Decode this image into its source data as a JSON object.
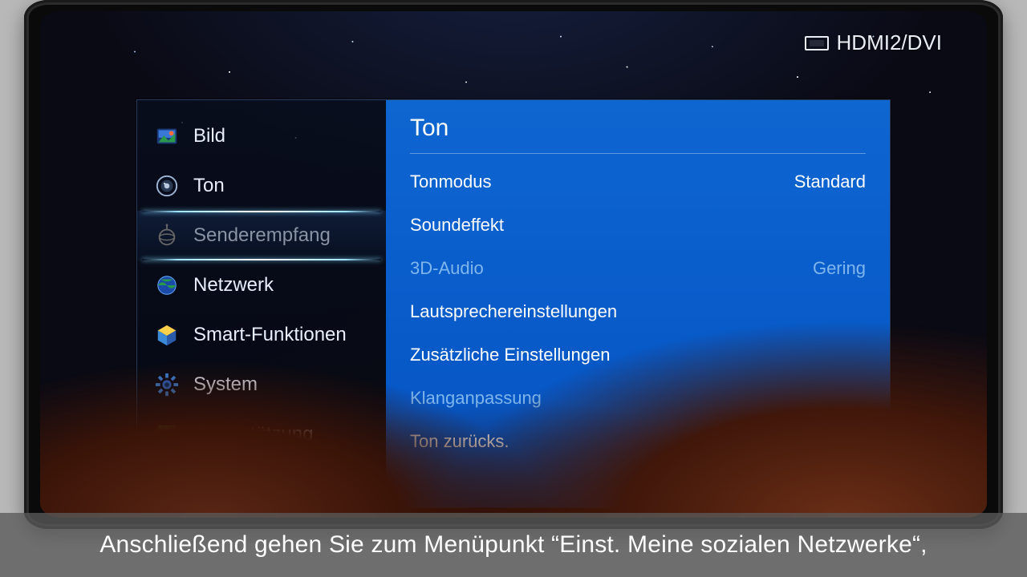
{
  "input_source": "HDMI2/DVI",
  "sidebar": {
    "items": [
      {
        "label": "Bild",
        "icon": "picture",
        "state": "normal"
      },
      {
        "label": "Ton",
        "icon": "speaker",
        "state": "normal"
      },
      {
        "label": "Senderempfang",
        "icon": "antenna",
        "state": "active-dim"
      },
      {
        "label": "Netzwerk",
        "icon": "globe",
        "state": "normal"
      },
      {
        "label": "Smart-Funktionen",
        "icon": "cube",
        "state": "normal"
      },
      {
        "label": "System",
        "icon": "gear",
        "state": "normal"
      },
      {
        "label": "Unterstützung",
        "icon": "help",
        "state": "normal"
      }
    ]
  },
  "panel": {
    "title": "Ton",
    "rows": [
      {
        "label": "Tonmodus",
        "value": "Standard",
        "disabled": false
      },
      {
        "label": "Soundeffekt",
        "value": "",
        "disabled": false
      },
      {
        "label": "3D-Audio",
        "value": "Gering",
        "disabled": true
      },
      {
        "label": "Lautsprechereinstellungen",
        "value": "",
        "disabled": false
      },
      {
        "label": "Zusätzliche Einstellungen",
        "value": "",
        "disabled": false
      },
      {
        "label": "Klanganpassung",
        "value": "",
        "disabled": true
      },
      {
        "label": "Ton zurücks.",
        "value": "",
        "disabled": false
      }
    ]
  },
  "subtitle": "Anschließend gehen Sie zum Menüpunkt “Einst. Meine sozialen Netzwerke“,"
}
